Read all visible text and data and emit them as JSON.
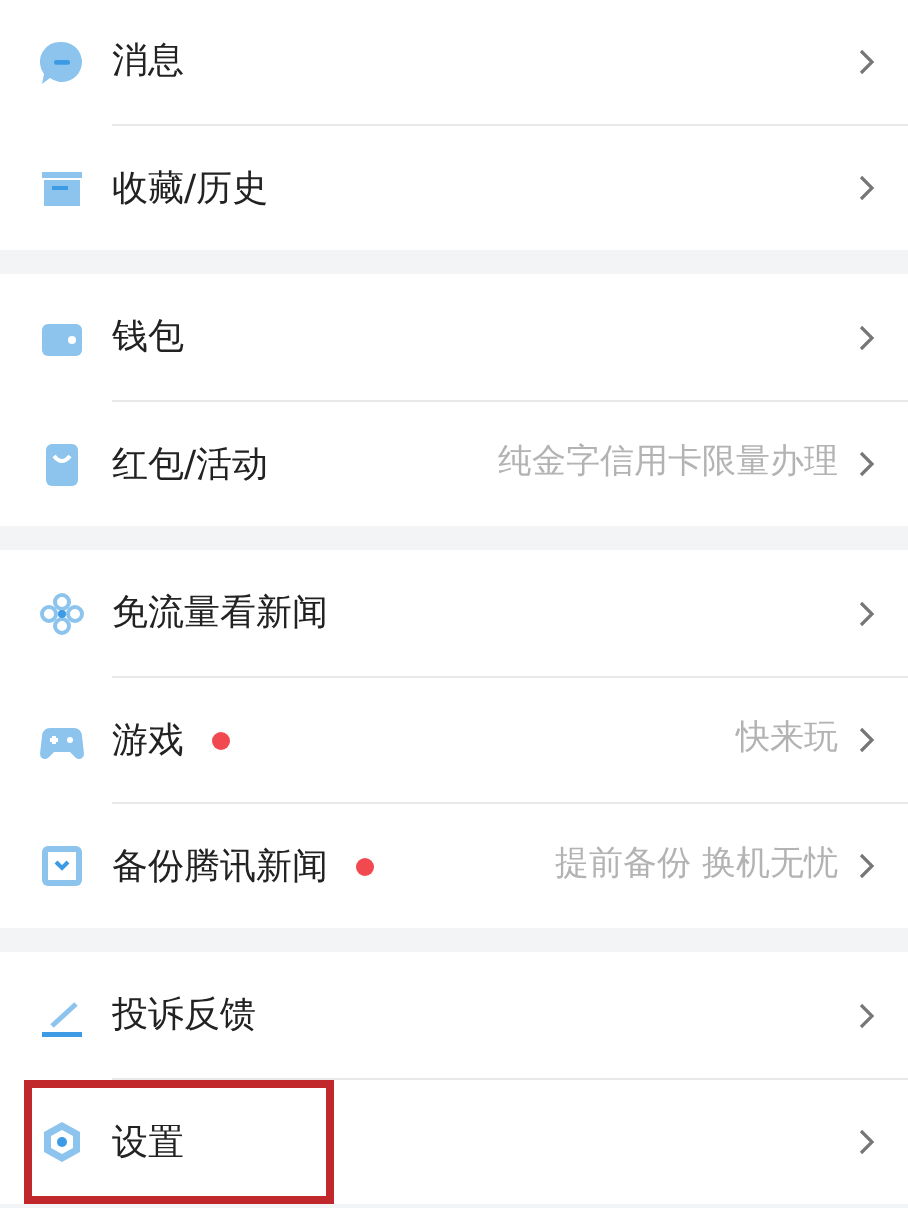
{
  "groups": [
    {
      "items": [
        {
          "kind": "chat",
          "label": "消息",
          "dot": false,
          "highlighted": false
        },
        {
          "kind": "box",
          "label": "收藏/历史",
          "dot": false,
          "highlighted": false
        }
      ]
    },
    {
      "items": [
        {
          "kind": "wallet",
          "label": "钱包",
          "dot": false,
          "highlighted": false
        },
        {
          "kind": "bag",
          "label": "红包/活动",
          "hint": "纯金字信用卡限量办理",
          "dot": false,
          "highlighted": false
        }
      ]
    },
    {
      "items": [
        {
          "kind": "flower",
          "label": "免流量看新闻",
          "dot": false,
          "highlighted": false
        },
        {
          "kind": "gamepad",
          "label": "游戏",
          "hint": "快来玩",
          "dot": true,
          "highlighted": false
        },
        {
          "kind": "backup",
          "label": "备份腾讯新闻",
          "hint": "提前备份 换机无忧",
          "dot": true,
          "highlighted": false
        }
      ]
    },
    {
      "items": [
        {
          "kind": "pen",
          "label": "投诉反馈",
          "dot": false,
          "highlighted": false
        },
        {
          "kind": "hex",
          "label": "设置",
          "dot": false,
          "highlighted": true
        }
      ]
    }
  ]
}
